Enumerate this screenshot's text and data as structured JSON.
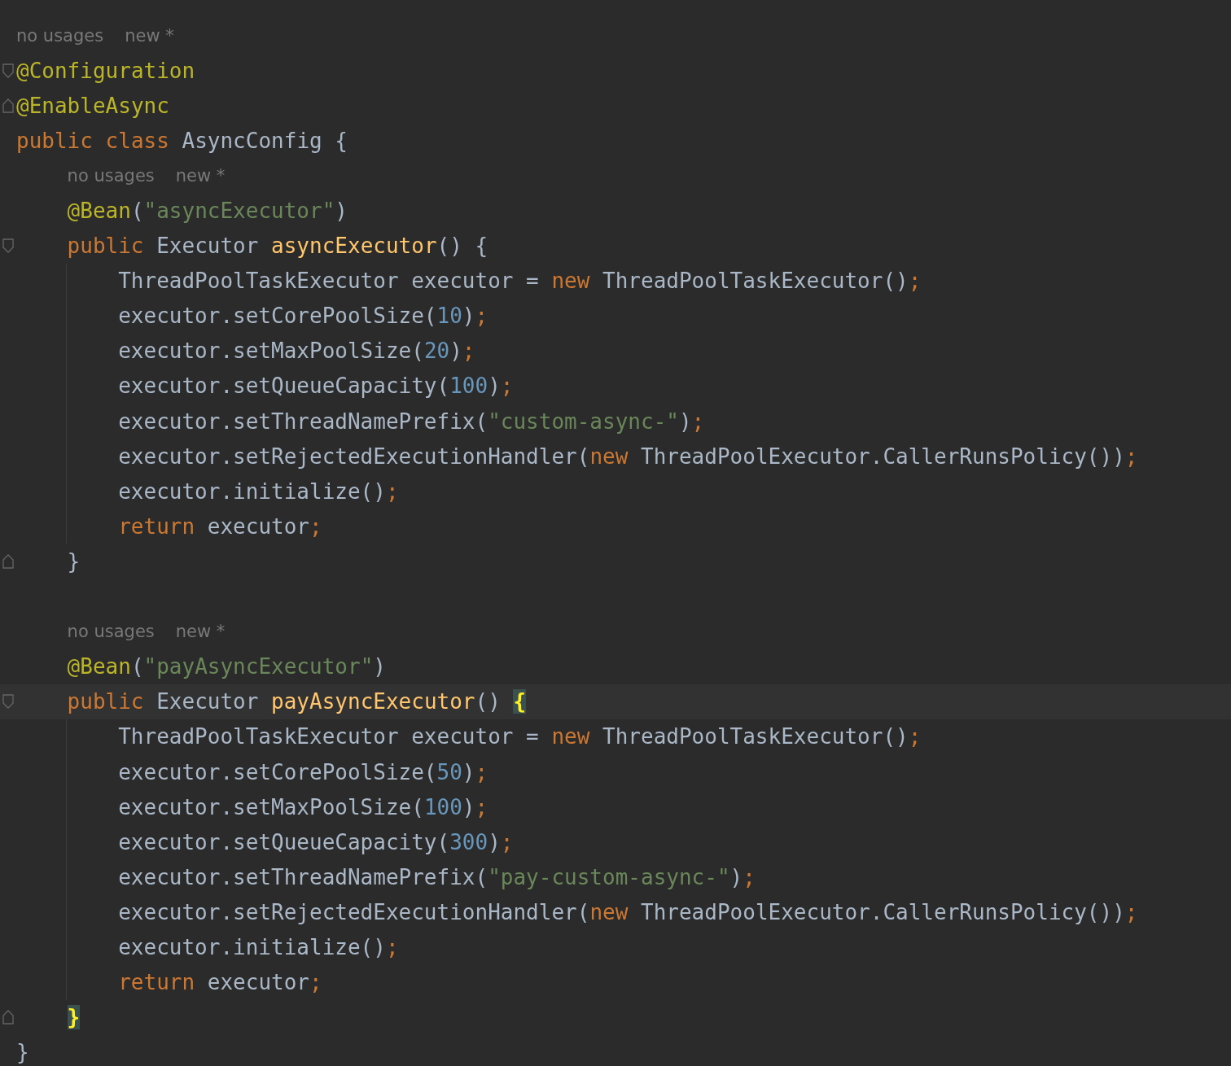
{
  "lines": [
    {
      "kind": "hint",
      "texts": [
        "no usages",
        "new *"
      ]
    },
    {
      "kind": "code",
      "fold": {
        "kind": "start"
      },
      "tokens": [
        {
          "text": "@Configuration",
          "kind": "annotation"
        }
      ]
    },
    {
      "kind": "code",
      "fold": {
        "kind": "end"
      },
      "tokens": [
        {
          "text": "@EnableAsync",
          "kind": "annotation"
        }
      ]
    },
    {
      "kind": "code",
      "tokens": [
        {
          "text": "public class ",
          "kind": "keyword"
        },
        {
          "text": "AsyncConfig {",
          "kind": "plain"
        }
      ],
      "children": [
        {
          "kind": "hint",
          "texts": [
            "no usages",
            "new *"
          ]
        },
        {
          "kind": "code",
          "tokens": [
            {
              "text": "@Bean",
              "kind": "annotation"
            },
            {
              "text": "(",
              "kind": "plain"
            },
            {
              "text": "\"asyncExecutor\"",
              "kind": "string"
            },
            {
              "text": ")",
              "kind": "plain"
            }
          ]
        },
        {
          "kind": "code",
          "fold": {
            "kind": "start"
          },
          "tokens": [
            {
              "text": "public ",
              "kind": "keyword"
            },
            {
              "text": "Executor ",
              "kind": "plain"
            },
            {
              "text": "asyncExecutor",
              "kind": "method"
            },
            {
              "text": "() {",
              "kind": "plain"
            }
          ],
          "children": [
            {
              "kind": "code",
              "tokens": [
                {
                  "text": "ThreadPoolTaskExecutor executor = ",
                  "kind": "plain"
                },
                {
                  "text": "new ",
                  "kind": "keyword"
                },
                {
                  "text": "ThreadPoolTaskExecutor()",
                  "kind": "plain"
                },
                {
                  "text": ";",
                  "kind": "keyword"
                }
              ]
            },
            {
              "kind": "code",
              "tokens": [
                {
                  "text": "executor.setCorePoolSize(",
                  "kind": "plain"
                },
                {
                  "text": "10",
                  "kind": "number"
                },
                {
                  "text": ")",
                  "kind": "plain"
                },
                {
                  "text": ";",
                  "kind": "keyword"
                }
              ]
            },
            {
              "kind": "code",
              "tokens": [
                {
                  "text": "executor.setMaxPoolSize(",
                  "kind": "plain"
                },
                {
                  "text": "20",
                  "kind": "number"
                },
                {
                  "text": ")",
                  "kind": "plain"
                },
                {
                  "text": ";",
                  "kind": "keyword"
                }
              ]
            },
            {
              "kind": "code",
              "tokens": [
                {
                  "text": "executor.setQueueCapacity(",
                  "kind": "plain"
                },
                {
                  "text": "100",
                  "kind": "number"
                },
                {
                  "text": ")",
                  "kind": "plain"
                },
                {
                  "text": ";",
                  "kind": "keyword"
                }
              ]
            },
            {
              "kind": "code",
              "tokens": [
                {
                  "text": "executor.setThreadNamePrefix(",
                  "kind": "plain"
                },
                {
                  "text": "\"custom-async-\"",
                  "kind": "string"
                },
                {
                  "text": ")",
                  "kind": "plain"
                },
                {
                  "text": ";",
                  "kind": "keyword"
                }
              ]
            },
            {
              "kind": "code",
              "tokens": [
                {
                  "text": "executor.setRejectedExecutionHandler(",
                  "kind": "plain"
                },
                {
                  "text": "new ",
                  "kind": "keyword"
                },
                {
                  "text": "ThreadPoolExecutor.CallerRunsPolicy())",
                  "kind": "plain"
                },
                {
                  "text": ";",
                  "kind": "keyword"
                }
              ]
            },
            {
              "kind": "code",
              "tokens": [
                {
                  "text": "executor.initialize()",
                  "kind": "plain"
                },
                {
                  "text": ";",
                  "kind": "keyword"
                }
              ]
            },
            {
              "kind": "code",
              "tokens": [
                {
                  "text": "return ",
                  "kind": "keyword"
                },
                {
                  "text": "executor",
                  "kind": "plain"
                },
                {
                  "text": ";",
                  "kind": "keyword"
                }
              ]
            }
          ]
        },
        {
          "kind": "code",
          "fold": {
            "kind": "end"
          },
          "tokens": [
            {
              "text": "}",
              "kind": "plain"
            }
          ]
        },
        {
          "kind": "blank"
        },
        {
          "kind": "hint",
          "texts": [
            "no usages",
            "new *"
          ]
        },
        {
          "kind": "code",
          "tokens": [
            {
              "text": "@Bean",
              "kind": "annotation"
            },
            {
              "text": "(",
              "kind": "plain"
            },
            {
              "text": "\"payAsyncExecutor\"",
              "kind": "string"
            },
            {
              "text": ")",
              "kind": "plain"
            }
          ]
        },
        {
          "kind": "code",
          "fold": {
            "kind": "start"
          },
          "current": true,
          "tokens": [
            {
              "text": "public ",
              "kind": "keyword"
            },
            {
              "text": "Executor ",
              "kind": "plain"
            },
            {
              "text": "payAsyncExecutor",
              "kind": "method"
            },
            {
              "text": "() ",
              "kind": "plain"
            },
            {
              "text": "{",
              "kind": "matched"
            }
          ],
          "children": [
            {
              "kind": "code",
              "tokens": [
                {
                  "text": "ThreadPoolTaskExecutor executor = ",
                  "kind": "plain"
                },
                {
                  "text": "new ",
                  "kind": "keyword"
                },
                {
                  "text": "ThreadPoolTaskExecutor()",
                  "kind": "plain"
                },
                {
                  "text": ";",
                  "kind": "keyword"
                }
              ]
            },
            {
              "kind": "code",
              "tokens": [
                {
                  "text": "executor.setCorePoolSize(",
                  "kind": "plain"
                },
                {
                  "text": "50",
                  "kind": "number"
                },
                {
                  "text": ")",
                  "kind": "plain"
                },
                {
                  "text": ";",
                  "kind": "keyword"
                }
              ]
            },
            {
              "kind": "code",
              "tokens": [
                {
                  "text": "executor.setMaxPoolSize(",
                  "kind": "plain"
                },
                {
                  "text": "100",
                  "kind": "number"
                },
                {
                  "text": ")",
                  "kind": "plain"
                },
                {
                  "text": ";",
                  "kind": "keyword"
                }
              ]
            },
            {
              "kind": "code",
              "tokens": [
                {
                  "text": "executor.setQueueCapacity(",
                  "kind": "plain"
                },
                {
                  "text": "300",
                  "kind": "number"
                },
                {
                  "text": ")",
                  "kind": "plain"
                },
                {
                  "text": ";",
                  "kind": "keyword"
                }
              ]
            },
            {
              "kind": "code",
              "tokens": [
                {
                  "text": "executor.setThreadNamePrefix(",
                  "kind": "plain"
                },
                {
                  "text": "\"pay-custom-async-\"",
                  "kind": "string"
                },
                {
                  "text": ")",
                  "kind": "plain"
                },
                {
                  "text": ";",
                  "kind": "keyword"
                }
              ]
            },
            {
              "kind": "code",
              "tokens": [
                {
                  "text": "executor.setRejectedExecutionHandler(",
                  "kind": "plain"
                },
                {
                  "text": "new ",
                  "kind": "keyword"
                },
                {
                  "text": "ThreadPoolExecutor.CallerRunsPolicy())",
                  "kind": "plain"
                },
                {
                  "text": ";",
                  "kind": "keyword"
                }
              ]
            },
            {
              "kind": "code",
              "tokens": [
                {
                  "text": "executor.initialize()",
                  "kind": "plain"
                },
                {
                  "text": ";",
                  "kind": "keyword"
                }
              ]
            },
            {
              "kind": "code",
              "tokens": [
                {
                  "text": "return ",
                  "kind": "keyword"
                },
                {
                  "text": "executor",
                  "kind": "plain"
                },
                {
                  "text": ";",
                  "kind": "keyword"
                }
              ]
            }
          ]
        },
        {
          "kind": "code",
          "fold": {
            "kind": "end"
          },
          "tokens": [
            {
              "text": "}",
              "kind": "matched"
            }
          ]
        }
      ]
    },
    {
      "kind": "code",
      "tokens": [
        {
          "text": "}",
          "kind": "plain"
        }
      ]
    }
  ]
}
